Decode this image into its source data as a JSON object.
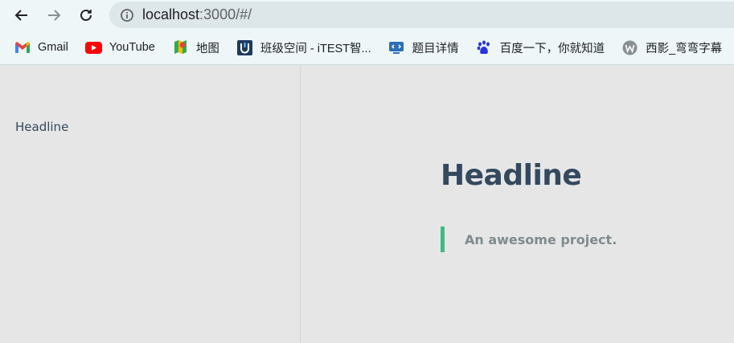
{
  "browser": {
    "url_host": "localhost",
    "url_rest": ":3000/#/",
    "bookmarks": [
      {
        "label": "Gmail",
        "icon": "gmail-icon"
      },
      {
        "label": "YouTube",
        "icon": "youtube-icon"
      },
      {
        "label": "地图",
        "icon": "maps-icon"
      },
      {
        "label": "班级空间 - iTEST智...",
        "icon": "itest-icon"
      },
      {
        "label": "题目详情",
        "icon": "code-icon"
      },
      {
        "label": "百度一下，你就知道",
        "icon": "baidu-icon"
      },
      {
        "label": "西影_弯弯字幕",
        "icon": "w-icon"
      }
    ]
  },
  "sidebar": {
    "link_label": "Headline"
  },
  "cover": {
    "title": "Headline",
    "tagline": "An awesome project."
  },
  "colors": {
    "accent": "#42b983",
    "title": "#34495e",
    "tagline": "#7f8c8d"
  }
}
